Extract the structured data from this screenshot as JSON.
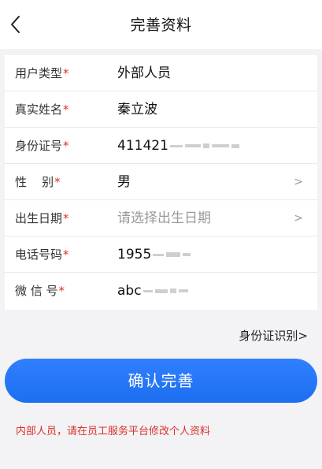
{
  "header": {
    "title": "完善资料"
  },
  "form": {
    "rows": [
      {
        "label": "用户类型",
        "value": "外部人员"
      },
      {
        "label": "真实姓名",
        "value": "秦立波"
      },
      {
        "label": "身份证号",
        "value": "411421"
      },
      {
        "label": "性    别",
        "value": "男"
      },
      {
        "label": "出生日期",
        "value": "",
        "placeholder": "请选择出生日期"
      },
      {
        "label": "电话号码",
        "value": "1955"
      },
      {
        "label": "微 信 号",
        "value": "abc"
      }
    ],
    "required_mark": "*",
    "chevron": ">"
  },
  "id_recognize_link": "身份证识别>",
  "confirm_button": "确认完善",
  "notice": "内部人员，请在员工服务平台修改个人资料",
  "colors": {
    "primary": "#1e6ff0",
    "required": "#e0302d",
    "notice": "#d9302b"
  }
}
